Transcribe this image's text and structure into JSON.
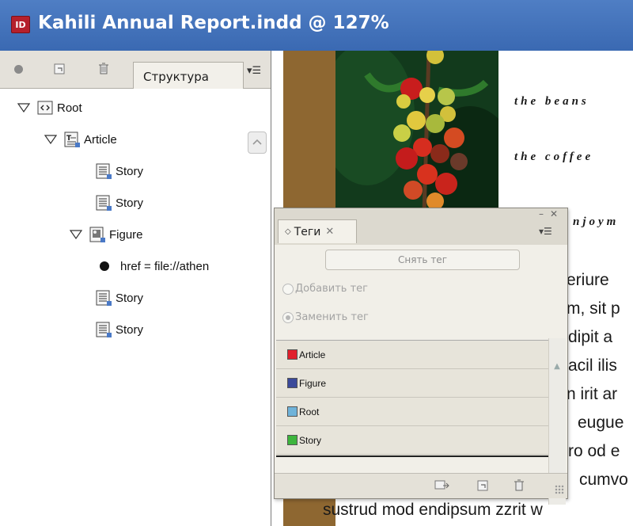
{
  "window": {
    "title": "Kahili Annual Report.indd @ 127%",
    "app_badge": "ID",
    "title_bar_color": "#3e6db6"
  },
  "structure_panel": {
    "tab_label": "Структура",
    "toolbar_icons": [
      "dot-icon",
      "add-element-icon",
      "trash-icon",
      "panel-menu-icon"
    ],
    "tree": [
      {
        "label": "Root",
        "icon": "root-element-icon",
        "expanded": true
      },
      {
        "label": "Article",
        "icon": "text-frame-element-icon",
        "expanded": true
      },
      {
        "label": "Story",
        "icon": "story-element-icon"
      },
      {
        "label": "Story",
        "icon": "story-element-icon"
      },
      {
        "label": "Figure",
        "icon": "image-frame-element-icon",
        "expanded": true
      },
      {
        "label": "href = file://athen",
        "icon": "attribute-bullet-icon"
      },
      {
        "label": "Story",
        "icon": "story-element-icon"
      },
      {
        "label": "Story",
        "icon": "story-element-icon"
      }
    ]
  },
  "document": {
    "heading_lines": [
      "the beans",
      "the coffee",
      "njoym"
    ],
    "body_lines": [
      "eriure",
      "m, sit p",
      "dipit a",
      "acil ilis",
      "n irit ar",
      "eugue",
      "ro od e",
      "cumvo"
    ],
    "bottom_line": "sustrud mod endipsum zzrit w",
    "accent_color": "#8e6731"
  },
  "tags_panel": {
    "tab_label": "Теги",
    "untag_button": "Снять тег",
    "add_tag_label": "Добавить тег",
    "replace_tag_label": "Заменить тег",
    "tags": [
      {
        "name": "Article",
        "color": "#e0202c"
      },
      {
        "name": "Figure",
        "color": "#3b4a9a"
      },
      {
        "name": "Root",
        "color": "#6fb3d9"
      },
      {
        "name": "Story",
        "color": "#3db53d"
      }
    ],
    "footer_icons": [
      "autotag-icon",
      "new-tag-icon",
      "delete-tag-icon"
    ]
  }
}
